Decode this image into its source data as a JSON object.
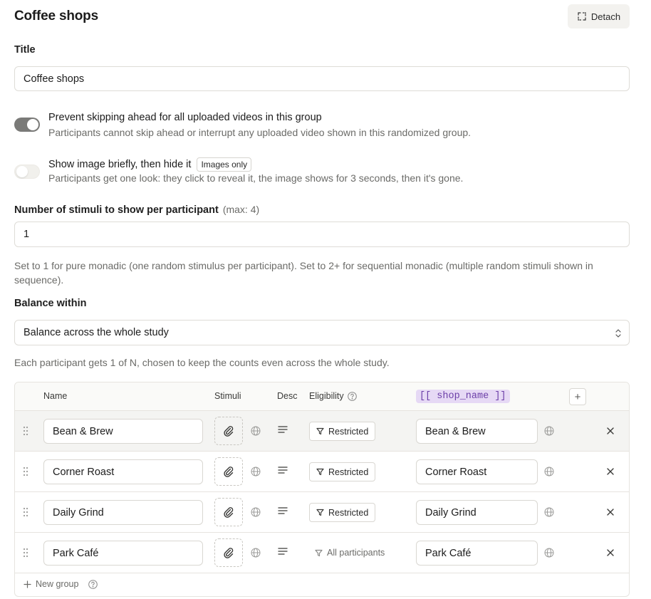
{
  "header": {
    "title": "Coffee shops",
    "detach_label": "Detach"
  },
  "title_field": {
    "label": "Title",
    "value": "Coffee shops"
  },
  "options": [
    {
      "title": "Prevent skipping ahead for all uploaded videos in this group",
      "description": "Participants cannot skip ahead or interrupt any uploaded video shown in this randomized group.",
      "enabled": true
    },
    {
      "title": "Show image briefly, then hide it",
      "badge": "Images only",
      "description": "Participants get one look: they click to reveal it, the image shows for 3 seconds, then it's gone.",
      "enabled": false
    }
  ],
  "stimuli_count": {
    "label": "Number of stimuli to show per participant",
    "max_note": "(max: 4)",
    "value": "1",
    "hint": "Set to 1 for pure monadic (one random stimulus per participant). Set to 2+ for sequential monadic (multiple random stimuli shown in sequence)."
  },
  "balance": {
    "label": "Balance within",
    "selected": "Balance across the whole study",
    "hint": "Each participant gets 1 of N, chosen to keep the counts even across the whole study."
  },
  "table": {
    "headers": {
      "name": "Name",
      "stimuli": "Stimuli",
      "desc": "Desc",
      "eligibility": "Eligibility",
      "variable": "[[ shop_name ]]"
    },
    "rows": [
      {
        "name": "Bean & Brew",
        "eligibility": "Restricted",
        "restricted": true,
        "value": "Bean & Brew"
      },
      {
        "name": "Corner Roast",
        "eligibility": "Restricted",
        "restricted": true,
        "value": "Corner Roast"
      },
      {
        "name": "Daily Grind",
        "eligibility": "Restricted",
        "restricted": true,
        "value": "Daily Grind"
      },
      {
        "name": "Park Café",
        "eligibility": "All participants",
        "restricted": false,
        "value": "Park Café"
      }
    ],
    "new_group_label": "New group"
  },
  "icons": [
    "detach-icon",
    "drag-handle-icon",
    "paperclip-icon",
    "globe-icon",
    "text-lines-icon",
    "filter-icon",
    "close-icon",
    "plus-icon",
    "help-icon",
    "chevron-updown-icon"
  ],
  "colors": {
    "accent_chip_bg": "#e6d9f5",
    "accent_chip_text": "#6c3fa8",
    "toggle_on": "#7a7a78"
  }
}
